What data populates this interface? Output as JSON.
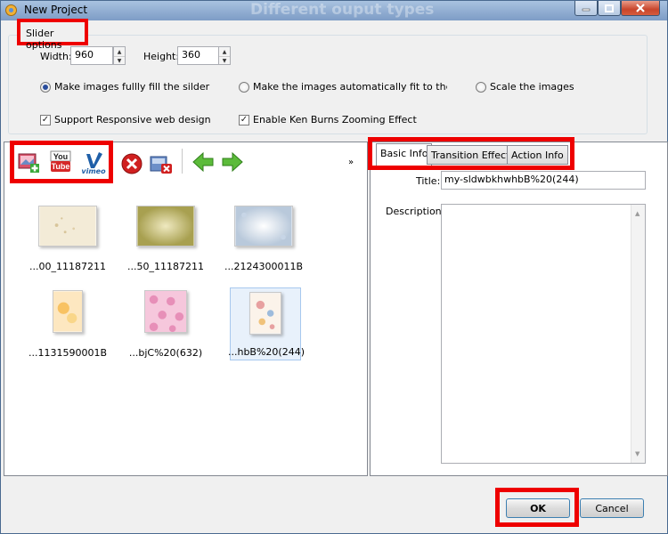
{
  "window": {
    "title": "New Project",
    "watermark": "Different ouput types"
  },
  "slider_options": {
    "group_label": "Slider options",
    "width_label": "Width:",
    "width_value": "960",
    "height_label": "Height:",
    "height_value": "360",
    "radios": [
      {
        "label": "Make images fullly fill the silder",
        "checked": true
      },
      {
        "label": "Make the images automatically fit to the slider",
        "checked": false
      },
      {
        "label": "Scale the images",
        "checked": false
      }
    ],
    "checkboxes": [
      {
        "label": "Support Responsive web design",
        "checked": true
      },
      {
        "label": "Enable Ken Burns Zooming Effect",
        "checked": true
      }
    ]
  },
  "toolbar": {
    "youtube_text_top": "You",
    "youtube_text_bottom": "Tube",
    "vimeo_text": "vimeo",
    "more": "»"
  },
  "thumbnails": [
    {
      "caption": "...00_11187211"
    },
    {
      "caption": "...50_11187211"
    },
    {
      "caption": "...2124300011B"
    },
    {
      "caption": "...1131590001B"
    },
    {
      "caption": "...bjC%20(632)"
    },
    {
      "caption": "...hbB%20(244)"
    }
  ],
  "tabs": [
    {
      "label": "Basic Info"
    },
    {
      "label": "Transition Effect"
    },
    {
      "label": "Action Info"
    }
  ],
  "basic_info": {
    "title_label": "Title:",
    "title_value": "my-sldwbkhwhbB%20(244)",
    "description_label": "Description:"
  },
  "buttons": {
    "ok": "OK",
    "cancel": "Cancel"
  }
}
